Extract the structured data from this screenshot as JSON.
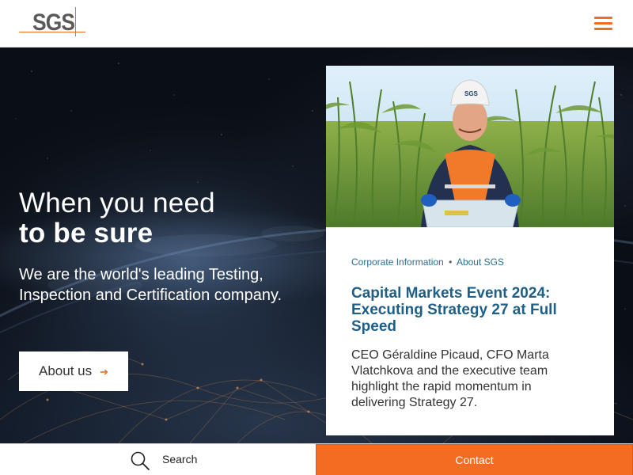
{
  "header": {
    "logo_text": "SGS",
    "menu_icon": "hamburger-menu-icon",
    "accent_color": "#f36c21"
  },
  "hero": {
    "title_line1": "When you need",
    "title_line2": "to be sure",
    "subtitle": "We are the world's leading Testing, Inspection and Certification company.",
    "cta_label": "About us",
    "cta_icon": "arrow-right-icon"
  },
  "card": {
    "category": "Corporate Information",
    "separator": "•",
    "subcategory": "About SGS",
    "helmet_label": "SGS",
    "title": "Capital Markets Event 2024: Executing Strategy 27 at Full Speed",
    "description": "CEO Géraldine Picaud, CFO Marta Vlatchkova and the executive team highlight the rapid momentum in delivering Strategy 27.",
    "title_color": "#1d5f86"
  },
  "bottom_bar": {
    "search_label": "Search",
    "search_icon": "search-icon",
    "contact_label": "Contact",
    "contact_color": "#f36c21"
  }
}
